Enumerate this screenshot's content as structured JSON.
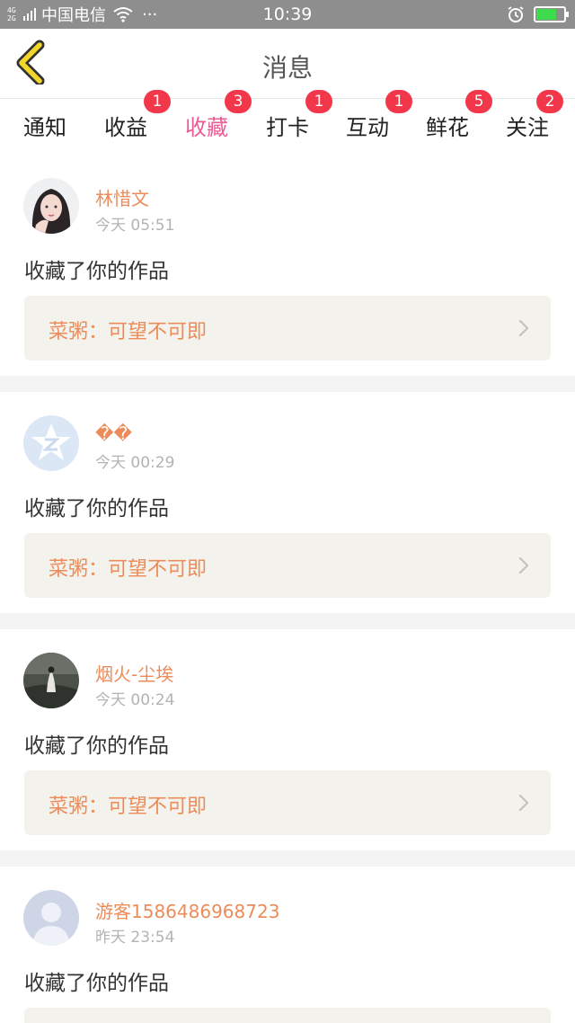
{
  "status_bar": {
    "network": "4G 2G",
    "carrier": "中国电信",
    "more": "···",
    "time": "10:39",
    "battery_level": 0.7,
    "icons": [
      "signal-icon",
      "wifi-icon",
      "alarm-icon",
      "battery-charging-icon"
    ]
  },
  "header": {
    "title": "消息",
    "back_icon": "chevron-left-icon"
  },
  "tabs": [
    {
      "label": "通知",
      "badge": ""
    },
    {
      "label": "收益",
      "badge": "1"
    },
    {
      "label": "收藏",
      "badge": "3",
      "active": true
    },
    {
      "label": "打卡",
      "badge": "1"
    },
    {
      "label": "互动",
      "badge": "1"
    },
    {
      "label": "鲜花",
      "badge": "5"
    },
    {
      "label": "关注",
      "badge": "2"
    }
  ],
  "messages": [
    {
      "name": "林惜文",
      "time": "今天 05:51",
      "action": "收藏了你的作品",
      "work": "菜粥：可望不可即"
    },
    {
      "name": "��",
      "time": "今天 00:29",
      "action": "收藏了你的作品",
      "work": "菜粥：可望不可即"
    },
    {
      "name": "烟火-尘埃",
      "time": "今天 00:24",
      "action": "收藏了你的作品",
      "work": "菜粥：可望不可即"
    },
    {
      "name": "游客1586486968723",
      "time": "昨天 23:54",
      "action": "收藏了你的作品",
      "work": ""
    }
  ],
  "colors": {
    "accent": "#ea5c92",
    "name": "#eb8c5a",
    "badge": "#f2374a",
    "work_bg": "#f3f2ec"
  }
}
